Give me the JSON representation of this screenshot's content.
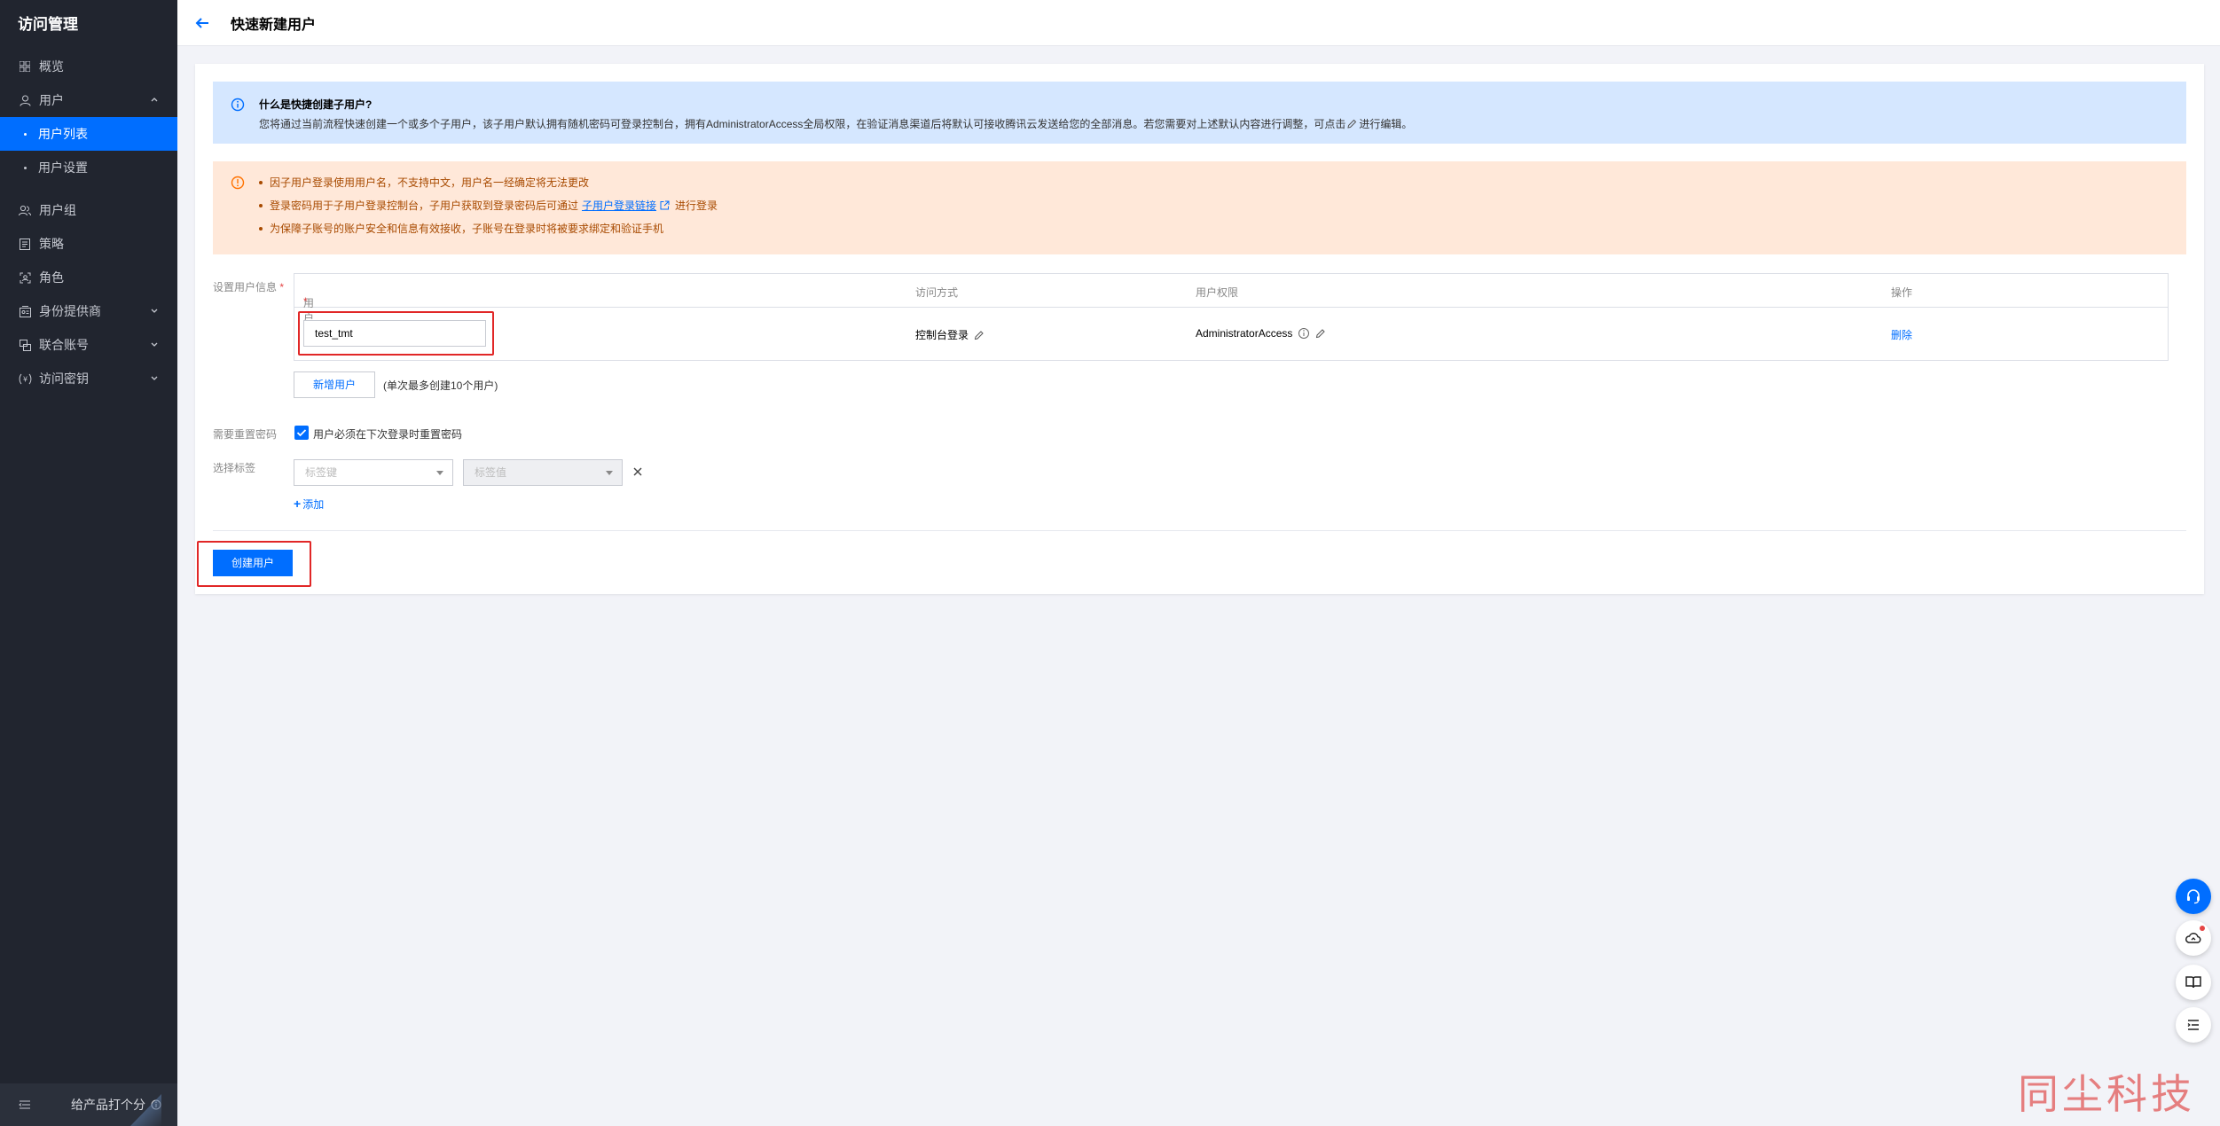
{
  "sidebar": {
    "title": "访问管理",
    "items": [
      {
        "label": "概览",
        "icon": "grid-icon"
      },
      {
        "label": "用户",
        "icon": "user-icon"
      },
      {
        "label": "用户组",
        "icon": "user-group-icon"
      },
      {
        "label": "策略",
        "icon": "policy-icon"
      },
      {
        "label": "角色",
        "icon": "role-icon"
      },
      {
        "label": "身份提供商",
        "icon": "identity-provider-icon"
      },
      {
        "label": "联合账号",
        "icon": "federated-account-icon"
      },
      {
        "label": "访问密钥",
        "icon": "access-key-icon"
      }
    ],
    "sub_items": [
      {
        "label": "用户列表",
        "active": true
      },
      {
        "label": "用户设置",
        "active": false
      }
    ],
    "footer": {
      "rate_label": "给产品打个分"
    }
  },
  "header": {
    "title": "快速新建用户"
  },
  "info": {
    "title": "什么是快捷创建子用户?",
    "desc_before": "您将通过当前流程快速创建一个或多个子用户，该子用户默认拥有随机密码可登录控制台，拥有AdministratorAccess全局权限，在验证消息渠道后将默认可接收腾讯云发送给您的全部消息。若您需要对上述默认内容进行调整，可点击",
    "desc_after": "进行编辑。"
  },
  "warning": {
    "item1": "因子用户登录使用用户名，不支持中文，用户名一经确定将无法更改",
    "item2_before": "登录密码用于子用户登录控制台，子用户获取到登录密码后可通过",
    "item2_link": "子用户登录链接",
    "item2_after": "进行登录",
    "item3": "为保障子账号的账户安全和信息有效接收，子账号在登录时将被要求绑定和验证手机"
  },
  "form": {
    "user_info_label": "设置用户信息",
    "required_mark": "*",
    "table": {
      "headers": {
        "username": "用户名",
        "access": "访问方式",
        "permission": "用户权限",
        "action": "操作"
      },
      "rows": [
        {
          "username": "test_tmt",
          "access": "控制台登录",
          "permission": "AdministratorAccess",
          "action": "删除"
        }
      ]
    },
    "add_user_button": "新增用户",
    "add_user_hint": "(单次最多创建10个用户)",
    "reset_password_label": "需要重置密码",
    "reset_password_checkbox": "用户必须在下次登录时重置密码",
    "reset_password_checked": true,
    "tags_label": "选择标签",
    "tag_key_placeholder": "标签键",
    "tag_value_placeholder": "标签值",
    "add_tag_link": "添加"
  },
  "footer": {
    "create_button": "创建用户"
  },
  "watermark": "同尘科技",
  "colors": {
    "primary": "#006eff",
    "sidebar_bg": "#21252f",
    "info_bg": "#d5e7ff",
    "warning_bg": "#ffe8d9",
    "highlight": "#e12727"
  }
}
